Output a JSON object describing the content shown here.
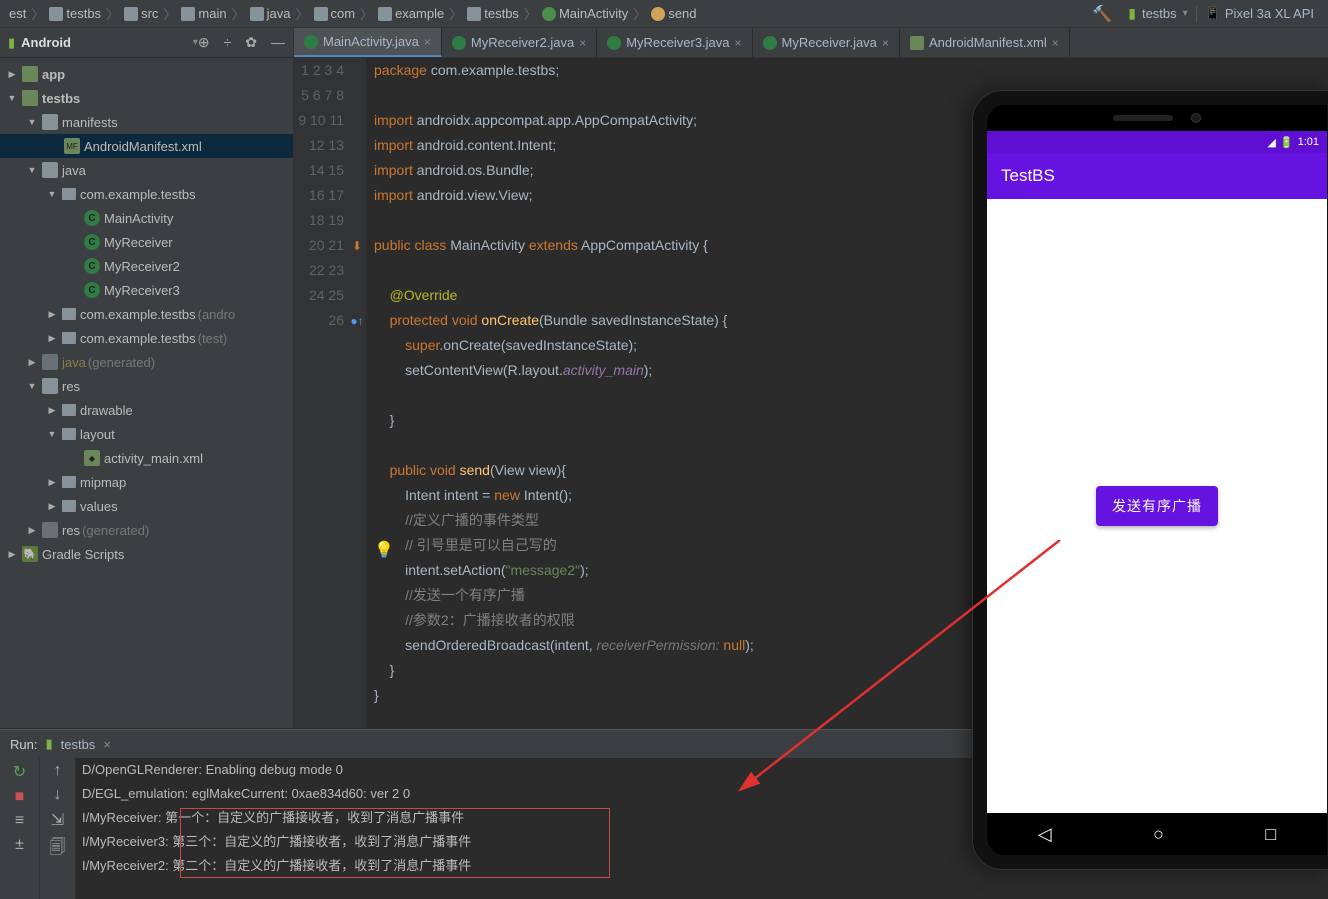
{
  "breadcrumb": [
    "est",
    "testbs",
    "src",
    "main",
    "java",
    "com",
    "example",
    "testbs",
    "MainActivity",
    "send"
  ],
  "runConfig": "testbs",
  "device": "Pixel 3a XL API",
  "sidebarTitle": "Android",
  "tree": {
    "app": "app",
    "testbs": "testbs",
    "manifests": "manifests",
    "manifestFile": "AndroidManifest.xml",
    "java": "java",
    "pkg": "com.example.testbs",
    "cls1": "MainActivity",
    "cls2": "MyReceiver",
    "cls3": "MyReceiver2",
    "cls4": "MyReceiver3",
    "pkgAndroid": "com.example.testbs",
    "pkgAndroidSuffix": "(andro",
    "pkgTest": "com.example.testbs",
    "pkgTestSuffix": "(test)",
    "javaGen": "java",
    "javaGenSuffix": "(generated)",
    "res": "res",
    "drawable": "drawable",
    "layout": "layout",
    "layoutFile": "activity_main.xml",
    "mipmap": "mipmap",
    "values": "values",
    "resGen": "res",
    "resGenSuffix": "(generated)",
    "gradle": "Gradle Scripts"
  },
  "tabs": [
    {
      "label": "MainActivity.java",
      "icon": "c",
      "active": true
    },
    {
      "label": "MyReceiver2.java",
      "icon": "c"
    },
    {
      "label": "MyReceiver3.java",
      "icon": "c"
    },
    {
      "label": "MyReceiver.java",
      "icon": "c"
    },
    {
      "label": "AndroidManifest.xml",
      "icon": "x"
    }
  ],
  "code": {
    "l1a": "package",
    "l1b": " com.example.testbs;",
    "l3a": "import",
    "l3b": " androidx.appcompat.app.AppCompatActivity;",
    "l4a": "import",
    "l4b": " android.content.Intent;",
    "l5a": "import",
    "l5b": " android.os.Bundle;",
    "l6a": "import",
    "l6b": " android.view.View;",
    "l8a": "public class ",
    "l8b": "MainActivity ",
    "l8c": "extends ",
    "l8d": "AppCompatActivity {",
    "l10": "@Override",
    "l11a": "protected void ",
    "l11b": "onCreate",
    "l11c": "(Bundle savedInstanceState) {",
    "l12a": "super",
    "l12b": ".onCreate(savedInstanceState);",
    "l13a": "setContentView(R.layout.",
    "l13b": "activity_main",
    "l13c": ");",
    "l15": "}",
    "l17a": "public void ",
    "l17b": "send",
    "l17c": "(View view){",
    "l18a": "Intent intent = ",
    "l18b": "new ",
    "l18c": "Intent();",
    "l19": "//定义广播的事件类型",
    "l20": "// 引号里是可以自己写的",
    "l21a": "intent.setAction(",
    "l21b": "\"message2\"",
    "l21c": ");",
    "l22": "//发送一个有序广播",
    "l23": "//参数2：广播接收者的权限",
    "l24a": "sendOrderedBroadcast(intent, ",
    "l24h": "receiverPermission: ",
    "l24b": "null",
    "l24c": ");",
    "l25": "}",
    "l26": "}"
  },
  "runPanel": {
    "title": "Run:",
    "app": "testbs",
    "lines": [
      "D/OpenGLRenderer: Enabling debug mode 0",
      "D/EGL_emulation: eglMakeCurrent: 0xae834d60: ver 2 0",
      "I/MyReceiver: 第一个：自定义的广播接收者，收到了消息广播事件",
      "I/MyReceiver3: 第三个：自定义的广播接收者，收到了消息广播事件",
      "I/MyReceiver2: 第二个：自定义的广播接收者，收到了消息广播事件"
    ]
  },
  "phone": {
    "time": "1:01",
    "appTitle": "TestBS",
    "button": "发送有序广播"
  }
}
